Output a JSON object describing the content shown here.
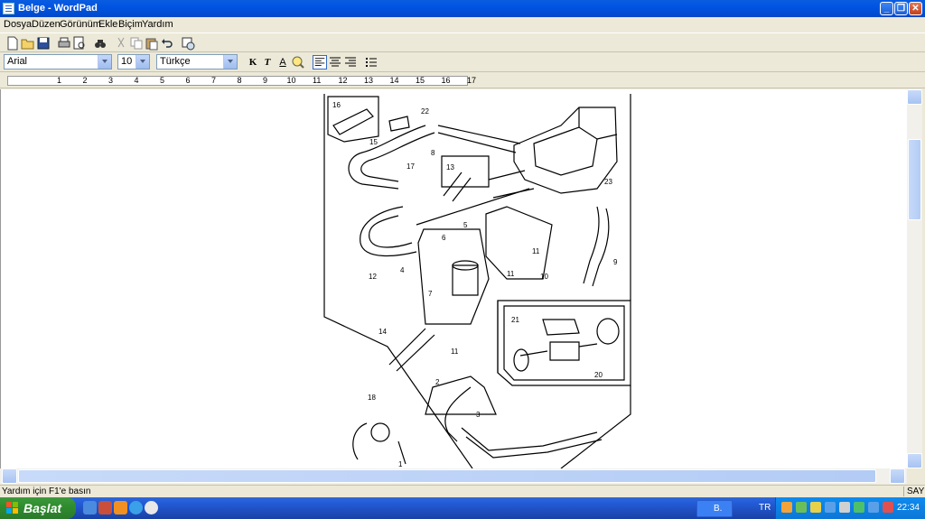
{
  "window": {
    "title": "Belge - WordPad"
  },
  "menu": {
    "items": [
      "Dosya",
      "Düzen",
      "Görünüm",
      "Ekle",
      "Biçim",
      "Yardım"
    ]
  },
  "format": {
    "font": "Arial",
    "size": "10",
    "script": "Türkçe"
  },
  "format_buttons": {
    "bold": "K",
    "italic": "T",
    "color": "A"
  },
  "ruler": {
    "numbers": [
      "1",
      "2",
      "3",
      "4",
      "5",
      "6",
      "7",
      "8",
      "9",
      "10",
      "11",
      "12",
      "13",
      "14",
      "15",
      "16",
      "17"
    ]
  },
  "diagram": {
    "labels": [
      "16",
      "22",
      "15",
      "8",
      "17",
      "13",
      "23",
      "5",
      "6",
      "4",
      "11",
      "11",
      "10",
      "7",
      "12",
      "9",
      "21",
      "14",
      "11",
      "20",
      "2",
      "3",
      "18",
      "1"
    ]
  },
  "status": {
    "help": "Yardım için F1'e basın",
    "mode": "SAYI"
  },
  "taskbar": {
    "start": "Başlat",
    "task": "B.",
    "lang": "TR",
    "clock": "22:34"
  }
}
